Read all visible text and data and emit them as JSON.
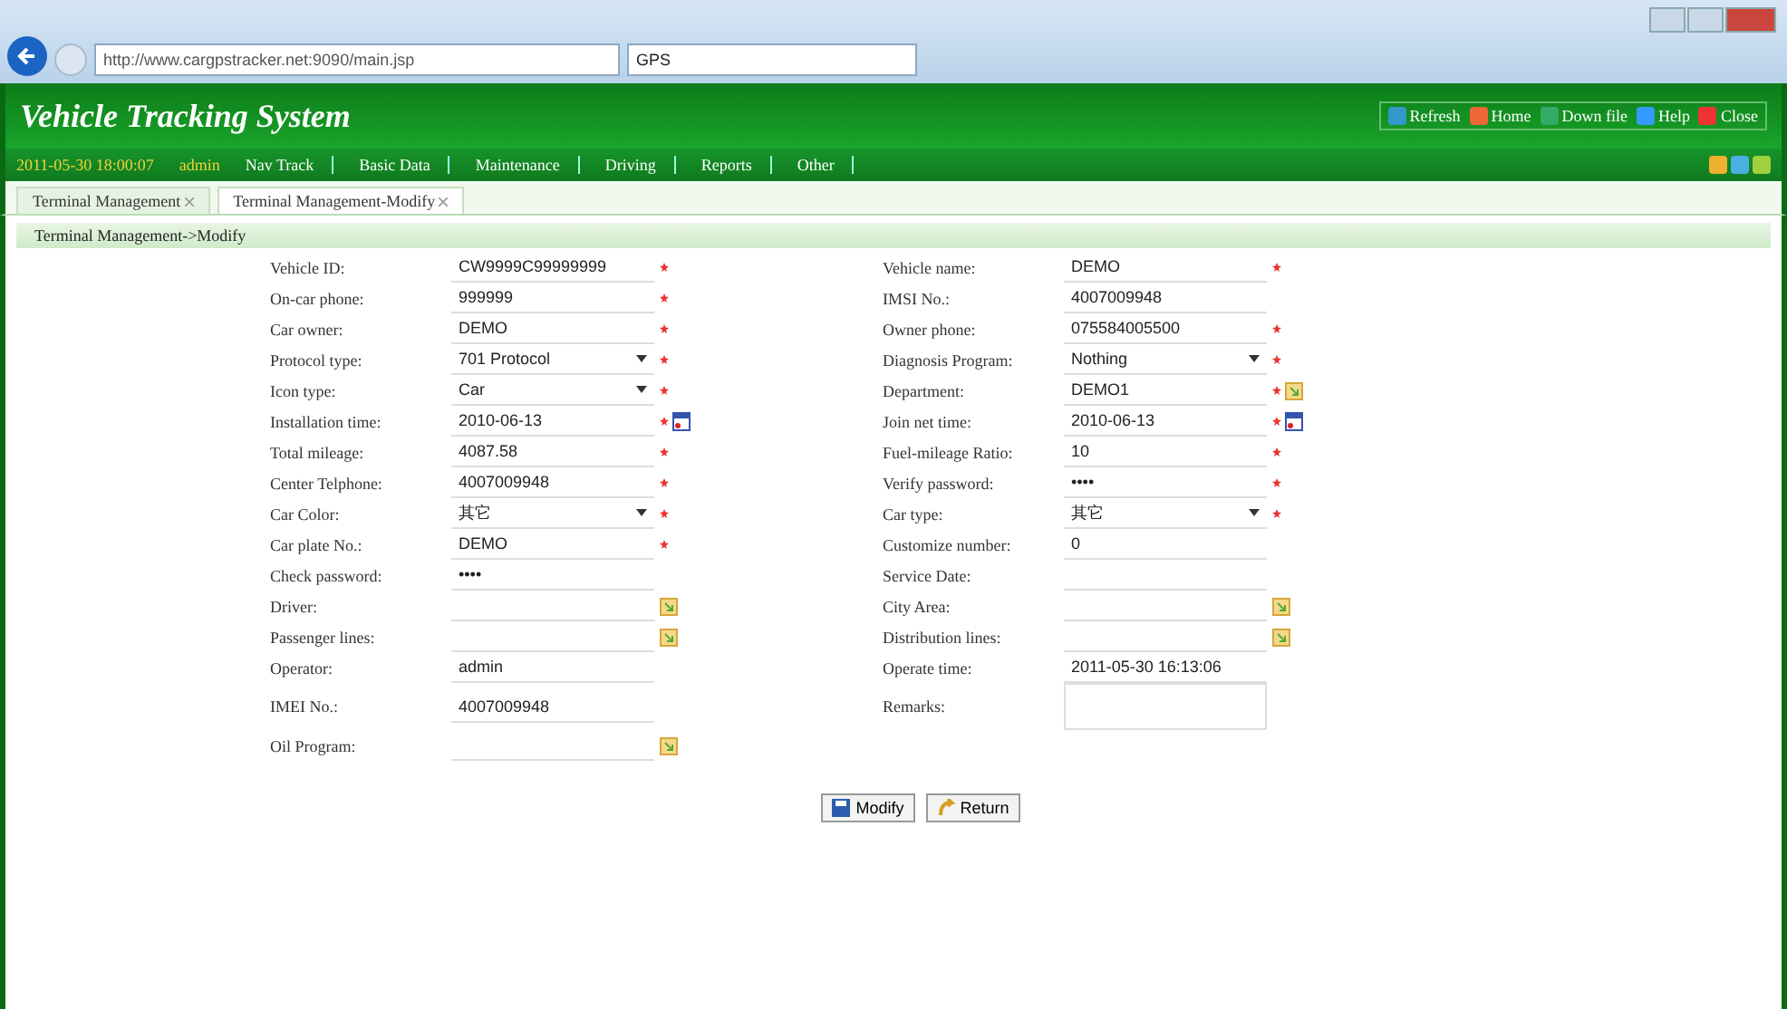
{
  "browser": {
    "address": "http://www.cargpstracker.net:9090/main.jsp",
    "tab_title": "GPS"
  },
  "header": {
    "title": "Vehicle Tracking System",
    "actions": [
      "Refresh",
      "Home",
      "Down file",
      "Help",
      "Close"
    ]
  },
  "menu_bar": {
    "datetime": "2011-05-30 18:00:07",
    "user": "admin",
    "items": [
      "Nav Track",
      "Basic Data",
      "Maintenance",
      "Driving",
      "Reports",
      "Other"
    ]
  },
  "tabs": [
    {
      "label": "Terminal Management",
      "selected": false
    },
    {
      "label": "Terminal Management-Modify",
      "selected": true
    }
  ],
  "breadcrumb": "Terminal Management->Modify",
  "form_rows": [
    {
      "left": {
        "label": "Vehicle ID:",
        "value": "CW9999C99999999",
        "kind": "text",
        "required": true
      },
      "right": {
        "label": "Vehicle name:",
        "value": "DEMO",
        "kind": "text",
        "required": true
      }
    },
    {
      "left": {
        "label": "On-car phone:",
        "value": "999999",
        "kind": "text",
        "required": true
      },
      "right": {
        "label": "IMSI No.:",
        "value": "4007009948",
        "kind": "text",
        "required": false
      }
    },
    {
      "left": {
        "label": "Car owner:",
        "value": "DEMO",
        "kind": "text",
        "required": true
      },
      "right": {
        "label": "Owner phone:",
        "value": "075584005500",
        "kind": "text",
        "required": true
      }
    },
    {
      "left": {
        "label": "Protocol type:",
        "value": "701 Protocol",
        "kind": "select",
        "required": true
      },
      "right": {
        "label": "Diagnosis Program:",
        "value": "Nothing",
        "kind": "select",
        "required": true
      }
    },
    {
      "left": {
        "label": "Icon type:",
        "value": "Car",
        "kind": "select",
        "required": true
      },
      "right": {
        "label": "Department:",
        "value": "DEMO1",
        "kind": "picker",
        "required": true
      }
    },
    {
      "left": {
        "label": "Installation time:",
        "value": "2010-06-13",
        "kind": "date",
        "required": true
      },
      "right": {
        "label": "Join net time:",
        "value": "2010-06-13",
        "kind": "date",
        "required": true
      }
    },
    {
      "left": {
        "label": "Total mileage:",
        "value": "4087.58",
        "kind": "text",
        "required": true
      },
      "right": {
        "label": "Fuel-mileage Ratio:",
        "value": "10",
        "kind": "text",
        "required": true
      }
    },
    {
      "left": {
        "label": "Center Telphone:",
        "value": "4007009948",
        "kind": "text",
        "required": true
      },
      "right": {
        "label": "Verify password:",
        "value": "••••",
        "kind": "text",
        "required": true
      }
    },
    {
      "left": {
        "label": "Car Color:",
        "value": "其它",
        "kind": "select",
        "required": true
      },
      "right": {
        "label": "Car type:",
        "value": "其它",
        "kind": "select",
        "required": true
      }
    },
    {
      "left": {
        "label": "Car plate No.:",
        "value": "DEMO",
        "kind": "text",
        "required": true
      },
      "right": {
        "label": "Customize number:",
        "value": "0",
        "kind": "text",
        "required": false
      }
    },
    {
      "left": {
        "label": "Check password:",
        "value": "••••",
        "kind": "text",
        "required": false
      },
      "right": {
        "label": "Service Date:",
        "kind": "text",
        "required": false
      }
    },
    {
      "left": {
        "label": "Driver:",
        "kind": "picker",
        "required": false
      },
      "right": {
        "label": "City Area:",
        "kind": "picker",
        "required": false
      }
    },
    {
      "left": {
        "label": "Passenger lines:",
        "kind": "picker",
        "required": false
      },
      "right": {
        "label": "Distribution lines:",
        "kind": "picker",
        "required": false
      }
    },
    {
      "left": {
        "label": "Operator:",
        "value": "admin",
        "kind": "text",
        "required": false
      },
      "right": {
        "label": "Operate time:",
        "value": "2011-05-30 16:13:06",
        "kind": "text",
        "required": false
      }
    },
    {
      "left": {
        "label": "IMEI No.:",
        "value": "4007009948",
        "kind": "text",
        "required": false
      },
      "right": {
        "label": "Remarks:",
        "kind": "textarea",
        "required": false
      }
    },
    {
      "left": {
        "label": "Oil Program:",
        "kind": "picker",
        "required": false
      }
    }
  ],
  "buttons": [
    "Modify",
    "Return"
  ]
}
